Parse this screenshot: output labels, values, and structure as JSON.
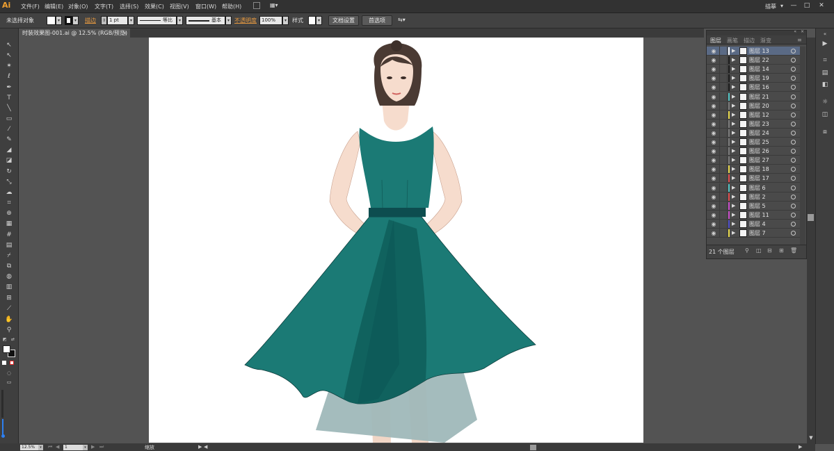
{
  "app": {
    "logo": "Ai"
  },
  "menu": [
    "文件(F)",
    "编辑(E)",
    "对象(O)",
    "文字(T)",
    "选择(S)",
    "效果(C)",
    "视图(V)",
    "窗口(W)",
    "帮助(H)"
  ],
  "workspace": {
    "label": "描摹"
  },
  "window_buttons": [
    "—",
    "□",
    "✕"
  ],
  "control_bar": {
    "selection_status": "未选择对象",
    "stroke_label": "描边",
    "stroke_weight": "1 pt",
    "profile_label": "等比",
    "brush_label": "基本",
    "opacity_label": "不透明度",
    "opacity_value": "100%",
    "style_label": "样式",
    "doc_setup_button": "文档设置",
    "prefs_button": "首选项"
  },
  "document_tab": "时装效果图-001.ai @ 12.5% (RGB/预览)",
  "layers_panel": {
    "tabs": [
      "图层",
      "画笔",
      "描边",
      "渐变"
    ],
    "active_tab": "图层",
    "layers": [
      {
        "name": "图层 13",
        "color": "#ffffff",
        "selected": true
      },
      {
        "name": "图层 22",
        "color": "#1a1a1a",
        "selected": false
      },
      {
        "name": "图层 14",
        "color": "#1a1a1a",
        "selected": false
      },
      {
        "name": "图层 19",
        "color": "#1a1a1a",
        "selected": false
      },
      {
        "name": "图层 16",
        "color": "#1a1a1a",
        "selected": false
      },
      {
        "name": "图层 21",
        "color": "#4fc3c3",
        "selected": false
      },
      {
        "name": "图层 20",
        "color": "#7a7a7a",
        "selected": false
      },
      {
        "name": "图层 12",
        "color": "#e8d84a",
        "selected": false
      },
      {
        "name": "图层 23",
        "color": "#7a7a7a",
        "selected": false
      },
      {
        "name": "图层 24",
        "color": "#7a7a7a",
        "selected": false
      },
      {
        "name": "图层 25",
        "color": "#7a7a7a",
        "selected": false
      },
      {
        "name": "图层 26",
        "color": "#7a7a7a",
        "selected": false
      },
      {
        "name": "图层 27",
        "color": "#7a7a7a",
        "selected": false
      },
      {
        "name": "图层 18",
        "color": "#e8d84a",
        "selected": false
      },
      {
        "name": "图层 17",
        "color": "#e04a4a",
        "selected": false
      },
      {
        "name": "图层 6",
        "color": "#4fc3c3",
        "selected": false
      },
      {
        "name": "图层 2",
        "color": "#e04a4a",
        "selected": false
      },
      {
        "name": "图层 5",
        "color": "#c84ac8",
        "selected": false
      },
      {
        "name": "图层 11",
        "color": "#c84ac8",
        "selected": false
      },
      {
        "name": "图层 4",
        "color": "#4a4ac8",
        "selected": false
      },
      {
        "name": "图层 7",
        "color": "#e8d84a",
        "selected": false
      }
    ],
    "footer_count": "21 个图层"
  },
  "status": {
    "zoom": "12.5%",
    "page": "1",
    "tool_status": "缩放"
  },
  "colors": {
    "dress": "#1b7a75",
    "dress_dark": "#0f5f5c",
    "belt": "#0d4d4f",
    "skin": "#f6dccd",
    "petticoat": "#9fb8b9"
  }
}
